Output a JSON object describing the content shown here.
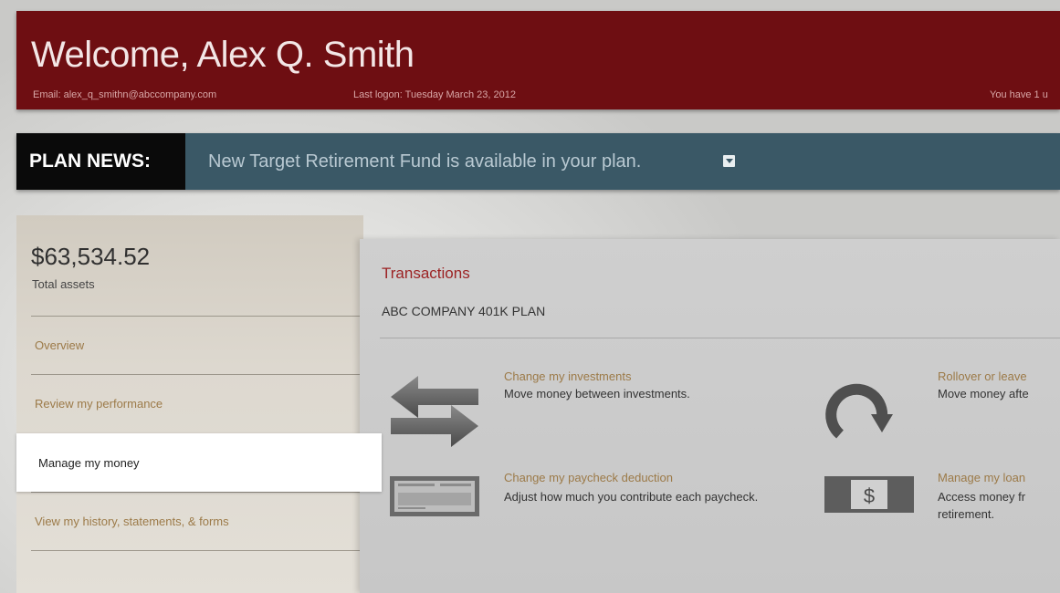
{
  "header": {
    "welcome": "Welcome, Alex Q. Smith",
    "email": "Email: alex_q_smithn@abccompany.com",
    "last_logon": "Last logon: Tuesday March 23, 2012",
    "notice": "You have 1 u"
  },
  "plan_news": {
    "label": "PLAN NEWS:",
    "message": "New Target Retirement Fund is available in your plan."
  },
  "sidebar": {
    "total_assets_value": "$63,534.52",
    "total_assets_label": "Total assets",
    "items": [
      {
        "label": "Overview",
        "active": false
      },
      {
        "label": "Review my performance",
        "active": false
      },
      {
        "label": "Manage my money",
        "active": true
      },
      {
        "label": "View my history, statements, & forms",
        "active": false
      }
    ]
  },
  "main": {
    "section_title": "Transactions",
    "plan_name": "ABC COMPANY 401K PLAN",
    "transactions": [
      {
        "title": "Change my investments",
        "description": "Move money between investments.",
        "icon": "exchange-arrows-icon"
      },
      {
        "title": "Rollover or leave",
        "description": "Move money afte",
        "icon": "circular-arrow-icon"
      },
      {
        "title": "Change my paycheck deduction",
        "description": "Adjust how much you contribute each paycheck.",
        "icon": "paycheck-icon"
      },
      {
        "title": "Manage my loan",
        "description": "Access money fr retirement.",
        "icon": "dollar-bill-icon"
      }
    ]
  },
  "colors": {
    "header_bg": "#6e0e12",
    "news_bg": "#3a5866",
    "accent_link": "#9c7a48",
    "section_title": "#9c2324"
  }
}
